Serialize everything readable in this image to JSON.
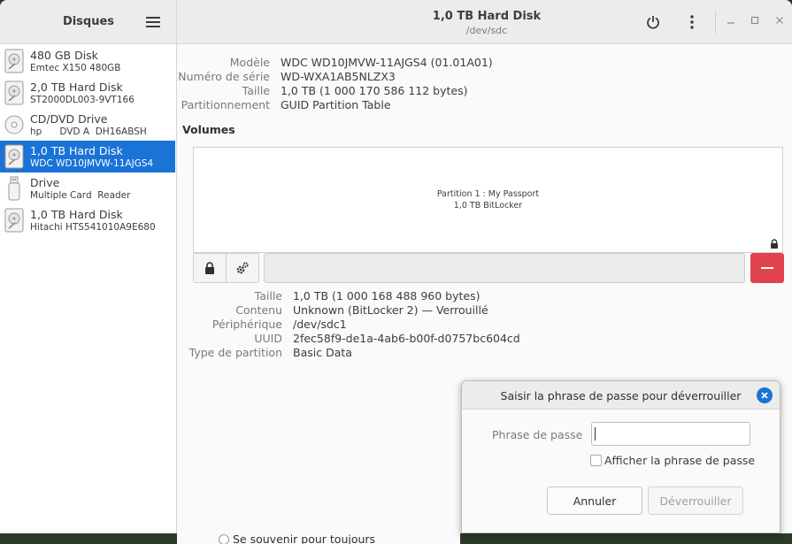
{
  "sidebar": {
    "title": "Disques",
    "devices": [
      {
        "name": "480 GB Disk",
        "detail": "Emtec X150 480GB",
        "icon": "hard-disk-icon",
        "selected": false
      },
      {
        "name": "2,0 TB Hard Disk",
        "detail": "ST2000DL003-9VT166",
        "icon": "hard-disk-icon",
        "selected": false
      },
      {
        "name": "CD/DVD Drive",
        "detail": "hp      DVD A  DH16ABSH",
        "icon": "optical-disc-icon",
        "selected": false
      },
      {
        "name": "1,0 TB Hard Disk",
        "detail": "WDC WD10JMVW-11AJGS4",
        "icon": "hard-disk-icon",
        "selected": true
      },
      {
        "name": "Drive",
        "detail": "Multiple Card  Reader",
        "icon": "usb-drive-icon",
        "selected": false
      },
      {
        "name": "1,0 TB Hard Disk",
        "detail": "Hitachi HTS541010A9E680",
        "icon": "hard-disk-icon",
        "selected": false
      }
    ]
  },
  "header": {
    "title": "1,0 TB Hard Disk",
    "subtitle": "/dev/sdc"
  },
  "disk": {
    "props": [
      {
        "label": "Modèle",
        "value": "WDC WD10JMVW-11AJGS4 (01.01A01)"
      },
      {
        "label": "Numéro de série",
        "value": "WD-WXA1AB5NLZX3"
      },
      {
        "label": "Taille",
        "value": "1,0 TB (1 000 170 586 112 bytes)"
      },
      {
        "label": "Partitionnement",
        "value": "GUID Partition Table"
      }
    ]
  },
  "volumes": {
    "title": "Volumes",
    "partition_line1": "Partition 1 : My Passport",
    "partition_line2": "1,0 TB BitLocker",
    "props": [
      {
        "label": "Taille",
        "value": "1,0 TB (1 000 168 488 960 bytes)"
      },
      {
        "label": "Contenu",
        "value": "Unknown (BitLocker 2) — Verrouillé"
      },
      {
        "label": "Périphérique",
        "value": "/dev/sdc1"
      },
      {
        "label": "UUID",
        "value": "2fec58f9-de1a-4ab6-b00f-d0757bc604cd"
      },
      {
        "label": "Type de partition",
        "value": "Basic Data"
      }
    ]
  },
  "dialog": {
    "title": "Saisir la phrase de passe pour déverrouiller",
    "passphrase_label": "Phrase de passe",
    "passphrase_value": "",
    "show_label": "Afficher la phrase de passe",
    "cancel_label": "Annuler",
    "unlock_label": "Déverrouiller"
  },
  "background_window": {
    "remember_label": "Se souvenir pour toujours"
  },
  "colors": {
    "accent": "#1a73d6",
    "danger": "#e0434b"
  }
}
